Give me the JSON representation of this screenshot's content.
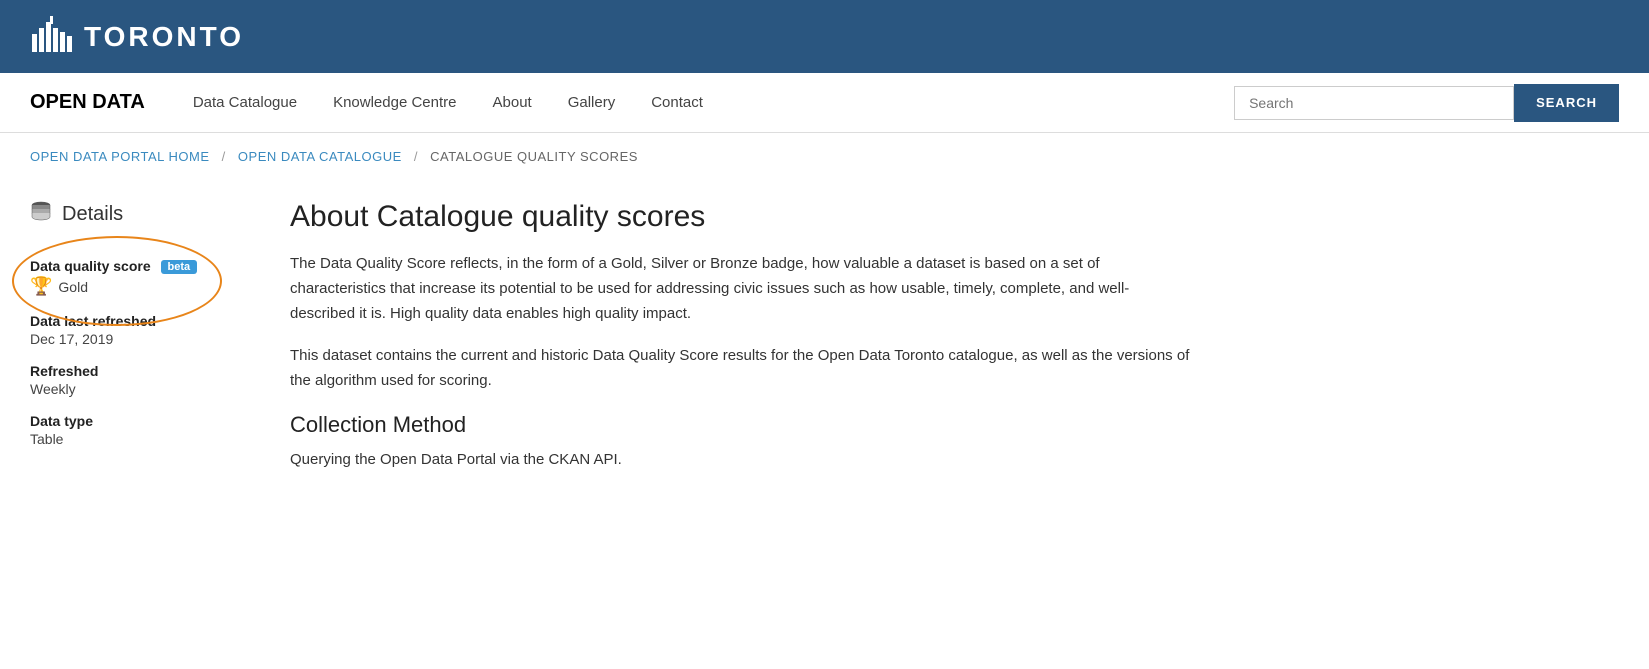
{
  "topBar": {
    "logoText": "TORONTO",
    "logoIconUnicode": "🏙"
  },
  "navBar": {
    "brand": "OPEN DATA",
    "links": [
      {
        "label": "Data Catalogue",
        "id": "data-catalogue"
      },
      {
        "label": "Knowledge Centre",
        "id": "knowledge-centre"
      },
      {
        "label": "About",
        "id": "about"
      },
      {
        "label": "Gallery",
        "id": "gallery"
      },
      {
        "label": "Contact",
        "id": "contact"
      }
    ],
    "search": {
      "placeholder": "Search",
      "buttonLabel": "SEARCH"
    }
  },
  "breadcrumb": {
    "items": [
      {
        "label": "OPEN DATA PORTAL HOME",
        "link": true
      },
      {
        "label": "OPEN DATA CATALOGUE",
        "link": true
      },
      {
        "label": "CATALOGUE QUALITY SCORES",
        "link": false
      }
    ]
  },
  "sidebar": {
    "title": "Details",
    "iconLabel": "database-stack-icon",
    "details": [
      {
        "id": "data-quality-score",
        "label": "Data quality score",
        "badge": "beta",
        "value": "Gold",
        "hasIcon": true,
        "iconLabel": "trophy-icon"
      },
      {
        "id": "data-last-refreshed",
        "label": "Data last refreshed",
        "value": "Dec 17, 2019"
      },
      {
        "id": "refreshed",
        "label": "Refreshed",
        "value": "Weekly"
      },
      {
        "id": "data-type",
        "label": "Data type",
        "value": "Table"
      }
    ]
  },
  "article": {
    "title": "About Catalogue quality scores",
    "paragraphs": [
      "The Data Quality Score reflects, in the form of a Gold, Silver or Bronze badge, how valuable a dataset is based on a set of characteristics that increase its potential to be used for addressing civic issues such as how usable, timely, complete, and well-described it is. High quality data enables high quality impact.",
      "This dataset contains the current and historic Data Quality Score results for the Open Data Toronto catalogue, as well as the versions of the algorithm used for scoring."
    ],
    "sections": [
      {
        "heading": "Collection Method",
        "content": "Querying the Open Data Portal via the CKAN API."
      }
    ]
  }
}
